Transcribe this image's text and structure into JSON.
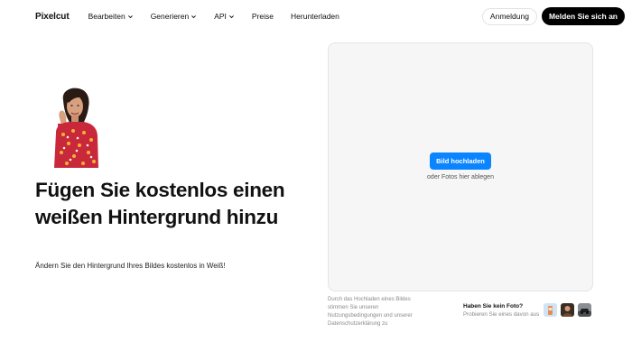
{
  "nav": {
    "logo": "Pixelcut",
    "items": [
      {
        "label": "Bearbeiten",
        "dropdown": true
      },
      {
        "label": "Generieren",
        "dropdown": true
      },
      {
        "label": "API",
        "dropdown": true
      },
      {
        "label": "Preise",
        "dropdown": false
      },
      {
        "label": "Herunterladen",
        "dropdown": false
      }
    ],
    "login_label": "Anmeldung",
    "signup_label": "Melden Sie sich an"
  },
  "hero": {
    "title": "Fügen Sie kostenlos einen weißen Hintergrund hinzu",
    "subtitle": "Ändern Sie den Hintergrund Ihres Bildes kostenlos in Weiß!"
  },
  "upload": {
    "button_label": "Bild hochladen",
    "drop_hint": "oder Fotos hier ablegen"
  },
  "legal": "Durch das Hochladen eines Bildes stimmen Sie unseren Nutzungsbedingungen und unserer Datenschutzerklärung zu",
  "no_photo": {
    "title": "Haben Sie kein Foto?",
    "subtitle": "Probieren Sie eines davon aus"
  },
  "colors": {
    "accent": "#0a84ff",
    "signup_bg": "#000000",
    "upload_bg": "#f6f6f7"
  }
}
